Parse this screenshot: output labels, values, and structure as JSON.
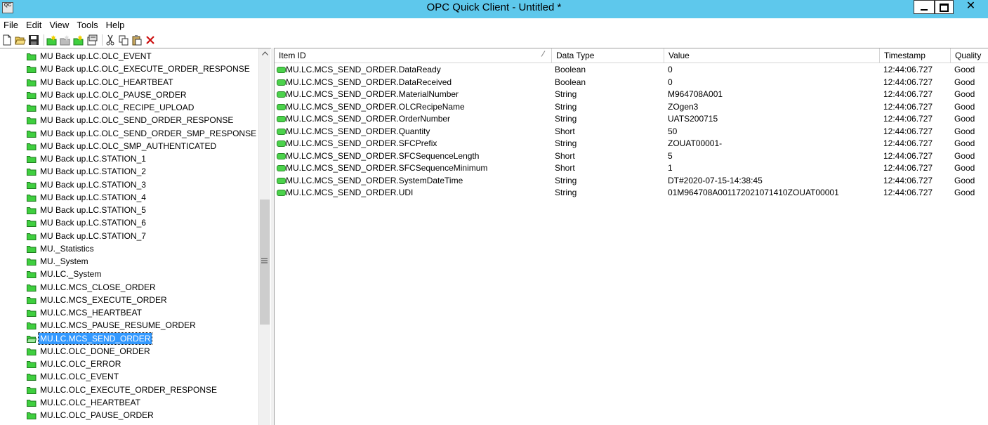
{
  "window": {
    "title": "OPC Quick Client - Untitled *",
    "icon_text": "QC",
    "close_glyph": "✕"
  },
  "menu": [
    "File",
    "Edit",
    "View",
    "Tools",
    "Help"
  ],
  "toolbar": {
    "icons": [
      "new-icon",
      "open-icon",
      "save-icon",
      "new-server-icon",
      "new-group-icon",
      "new-item-icon",
      "properties-icon",
      "cut-icon",
      "copy-icon",
      "paste-icon",
      "delete-icon"
    ]
  },
  "tree": {
    "items": [
      {
        "label": "MU Back up.LC.OLC_EVENT"
      },
      {
        "label": "MU Back up.LC.OLC_EXECUTE_ORDER_RESPONSE"
      },
      {
        "label": "MU Back up.LC.OLC_HEARTBEAT"
      },
      {
        "label": "MU Back up.LC.OLC_PAUSE_ORDER"
      },
      {
        "label": "MU Back up.LC.OLC_RECIPE_UPLOAD"
      },
      {
        "label": "MU Back up.LC.OLC_SEND_ORDER_RESPONSE"
      },
      {
        "label": "MU Back up.LC.OLC_SEND_ORDER_SMP_RESPONSE"
      },
      {
        "label": "MU Back up.LC.OLC_SMP_AUTHENTICATED"
      },
      {
        "label": "MU Back up.LC.STATION_1"
      },
      {
        "label": "MU Back up.LC.STATION_2"
      },
      {
        "label": "MU Back up.LC.STATION_3"
      },
      {
        "label": "MU Back up.LC.STATION_4"
      },
      {
        "label": "MU Back up.LC.STATION_5"
      },
      {
        "label": "MU Back up.LC.STATION_6"
      },
      {
        "label": "MU Back up.LC.STATION_7"
      },
      {
        "label": "MU._Statistics"
      },
      {
        "label": "MU._System"
      },
      {
        "label": "MU.LC._System"
      },
      {
        "label": "MU.LC.MCS_CLOSE_ORDER"
      },
      {
        "label": "MU.LC.MCS_EXECUTE_ORDER"
      },
      {
        "label": "MU.LC.MCS_HEARTBEAT"
      },
      {
        "label": "MU.LC.MCS_PAUSE_RESUME_ORDER"
      },
      {
        "label": "MU.LC.MCS_SEND_ORDER",
        "selected": true
      },
      {
        "label": "MU.LC.OLC_DONE_ORDER"
      },
      {
        "label": "MU.LC.OLC_ERROR"
      },
      {
        "label": "MU.LC.OLC_EVENT"
      },
      {
        "label": "MU.LC.OLC_EXECUTE_ORDER_RESPONSE"
      },
      {
        "label": "MU.LC.OLC_HEARTBEAT"
      },
      {
        "label": "MU.LC.OLC_PAUSE_ORDER"
      }
    ]
  },
  "list": {
    "columns": [
      "Item ID",
      "Data Type",
      "Value",
      "Timestamp",
      "Quality"
    ],
    "rows": [
      [
        "MU.LC.MCS_SEND_ORDER.DataReady",
        "Boolean",
        "0",
        "12:44:06.727",
        "Good"
      ],
      [
        "MU.LC.MCS_SEND_ORDER.DataReceived",
        "Boolean",
        "0",
        "12:44:06.727",
        "Good"
      ],
      [
        "MU.LC.MCS_SEND_ORDER.MaterialNumber",
        "String",
        "M964708A001",
        "12:44:06.727",
        "Good"
      ],
      [
        "MU.LC.MCS_SEND_ORDER.OLCRecipeName",
        "String",
        "ZOgen3",
        "12:44:06.727",
        "Good"
      ],
      [
        "MU.LC.MCS_SEND_ORDER.OrderNumber",
        "String",
        "UATS200715",
        "12:44:06.727",
        "Good"
      ],
      [
        "MU.LC.MCS_SEND_ORDER.Quantity",
        "Short",
        "50",
        "12:44:06.727",
        "Good"
      ],
      [
        "MU.LC.MCS_SEND_ORDER.SFCPrefix",
        "String",
        "ZOUAT00001-",
        "12:44:06.727",
        "Good"
      ],
      [
        "MU.LC.MCS_SEND_ORDER.SFCSequenceLength",
        "Short",
        "5",
        "12:44:06.727",
        "Good"
      ],
      [
        "MU.LC.MCS_SEND_ORDER.SFCSequenceMinimum",
        "Short",
        "1",
        "12:44:06.727",
        "Good"
      ],
      [
        "MU.LC.MCS_SEND_ORDER.SystemDateTime",
        "String",
        "DT#2020-07-15-14:38:45",
        "12:44:06.727",
        "Good"
      ],
      [
        "MU.LC.MCS_SEND_ORDER.UDI",
        "String",
        "01M964708A001172021071410ZOUAT00001",
        "12:44:06.727",
        "Good"
      ]
    ]
  },
  "colors": {
    "titlebar": "#5ec8ec",
    "selection": "#3399ff",
    "folder": "#3fcf3f",
    "item_icon": "#4cd24c"
  }
}
